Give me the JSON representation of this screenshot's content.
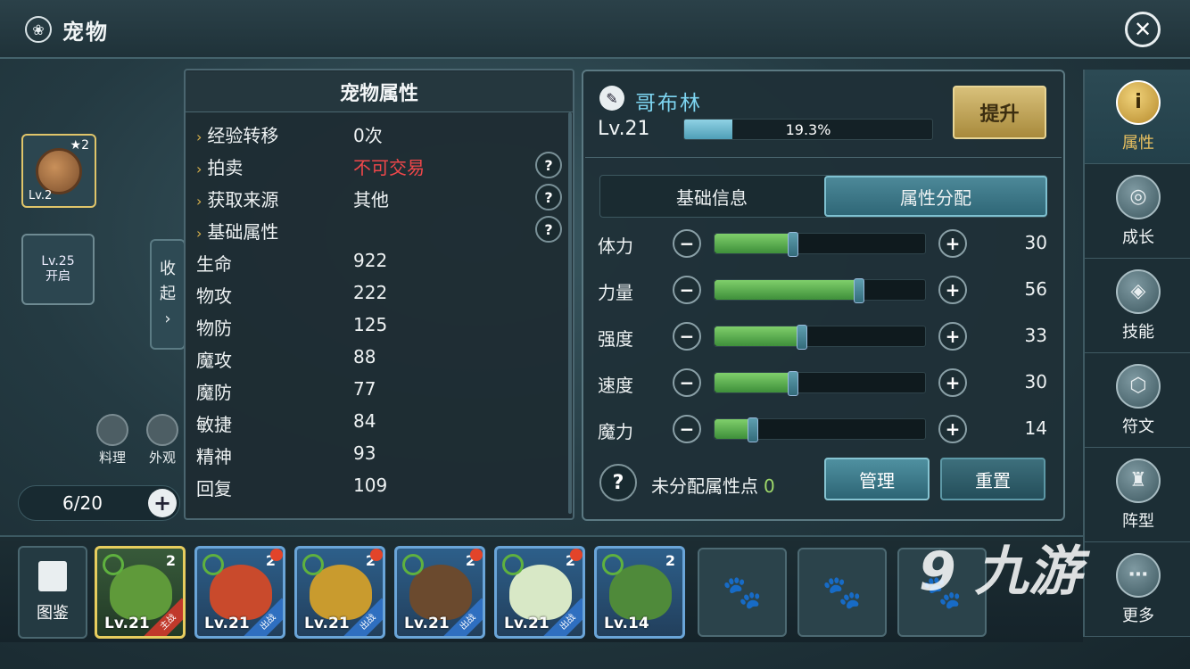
{
  "header": {
    "title": "宠物",
    "title_icon": "pet-paw-icon",
    "close_icon": "close-icon"
  },
  "left": {
    "slot1_level": "Lv.2",
    "slot1_stars": "★2",
    "slot2_text_line1": "Lv.25",
    "slot2_text_line2": "开启",
    "collapse_label_1": "收",
    "collapse_label_2": "起",
    "collapse_arrow": "›",
    "cook_label": "料理",
    "look_label": "外观",
    "pet_count": "6/20",
    "add_icon": "+"
  },
  "attr_panel": {
    "title": "宠物属性",
    "info_rows": [
      {
        "label": "经验转移",
        "value": "0次"
      },
      {
        "label": "拍卖",
        "value": "不可交易"
      },
      {
        "label": "获取来源",
        "value": "其他"
      },
      {
        "label": "基础属性",
        "value": ""
      }
    ],
    "stat_rows": [
      {
        "label": "生命",
        "value": "922"
      },
      {
        "label": "物攻",
        "value": "222"
      },
      {
        "label": "物防",
        "value": "125"
      },
      {
        "label": "魔攻",
        "value": "88"
      },
      {
        "label": "魔防",
        "value": "77"
      },
      {
        "label": "敏捷",
        "value": "84"
      },
      {
        "label": "精神",
        "value": "93"
      },
      {
        "label": "回复",
        "value": "109"
      }
    ],
    "help_icon": "?"
  },
  "detail": {
    "name": "哥布林",
    "level": "Lv.21",
    "xp_percent_text": "19.3%",
    "xp_fraction": 0.193,
    "upgrade_label": "提升",
    "tabs": [
      "基础信息",
      "属性分配"
    ],
    "stats": [
      {
        "label": "体力",
        "value": "30",
        "fill": 0.37
      },
      {
        "label": "力量",
        "value": "56",
        "fill": 0.68
      },
      {
        "label": "强度",
        "value": "33",
        "fill": 0.41
      },
      {
        "label": "速度",
        "value": "30",
        "fill": 0.37
      },
      {
        "label": "魔力",
        "value": "14",
        "fill": 0.18
      }
    ],
    "minus": "−",
    "plus": "+",
    "unassigned_label": "未分配属性点",
    "unassigned_value": "0",
    "manage_label": "管理",
    "reset_label": "重置"
  },
  "sidenav": [
    {
      "label": "属性",
      "icon": "info-icon",
      "glyph": "i"
    },
    {
      "label": "成长",
      "icon": "growth-icon",
      "glyph": "◎"
    },
    {
      "label": "技能",
      "icon": "skill-icon",
      "glyph": "◈"
    },
    {
      "label": "符文",
      "icon": "rune-icon",
      "glyph": "⬡"
    },
    {
      "label": "阵型",
      "icon": "formation-icon",
      "glyph": "♜"
    },
    {
      "label": "更多",
      "icon": "more-icon",
      "glyph": "⋯"
    }
  ],
  "bottom": {
    "atlas_label": "图鉴",
    "pets": [
      {
        "level": "Lv.21",
        "num": "2",
        "badge": "主战",
        "color": "#5f9a3a"
      },
      {
        "level": "Lv.21",
        "num": "2",
        "badge": "出战",
        "color": "#c94a2c"
      },
      {
        "level": "Lv.21",
        "num": "2",
        "badge": "出战",
        "color": "#c99b2e"
      },
      {
        "level": "Lv.21",
        "num": "2",
        "badge": "出战",
        "color": "#6b4a2e"
      },
      {
        "level": "Lv.21",
        "num": "2",
        "badge": "出战",
        "color": "#d8e8c6"
      },
      {
        "level": "Lv.14",
        "num": "2",
        "badge": "",
        "color": "#4f8a3a"
      }
    ],
    "empty_icon": "paw-icon"
  },
  "watermark": "九游"
}
